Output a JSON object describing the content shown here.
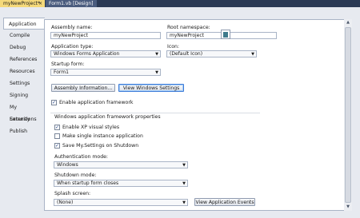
{
  "tabs": [
    {
      "label": "myNewProject*",
      "close": "×"
    },
    {
      "label": "Form1.vb [Design]"
    }
  ],
  "sidebar": {
    "items": [
      {
        "label": "Application"
      },
      {
        "label": "Compile"
      },
      {
        "label": "Debug"
      },
      {
        "label": "References"
      },
      {
        "label": "Resources"
      },
      {
        "label": "Settings"
      },
      {
        "label": "Signing"
      },
      {
        "label": "My Extensions"
      },
      {
        "label": "Security"
      },
      {
        "label": "Publish"
      }
    ]
  },
  "form": {
    "assembly_name_label": "Assembly name:",
    "assembly_name_value": "myNewProject",
    "root_namespace_label": "Root namespace:",
    "root_namespace_value": "myNewProject",
    "application_type_label": "Application type:",
    "application_type_value": "Windows Forms Application",
    "icon_label": "Icon:",
    "icon_value": "(Default Icon)",
    "startup_form_label": "Startup form:",
    "startup_form_value": "Form1",
    "assembly_info_button": "Assembly Information...",
    "view_windows_settings_button": "View Windows Settings",
    "enable_app_framework_label": "Enable application framework",
    "enable_app_framework_checked": "✓",
    "group_title": "Windows application framework properties",
    "xp_styles_label": "Enable XP visual styles",
    "xp_styles_checked": "✓",
    "single_instance_label": "Make single instance application",
    "single_instance_checked": "",
    "save_settings_label": "Save My.Settings on Shutdown",
    "save_settings_checked": "✓",
    "auth_mode_label": "Authentication mode:",
    "auth_mode_value": "Windows",
    "shutdown_mode_label": "Shutdown mode:",
    "shutdown_mode_value": "When startup form closes",
    "splash_screen_label": "Splash screen:",
    "splash_screen_value": "(None)",
    "view_app_events_button": "View Application Events"
  },
  "icons": {
    "dropdown_arrow": "▼",
    "scroll_up": "▲",
    "scroll_down": "▼"
  }
}
